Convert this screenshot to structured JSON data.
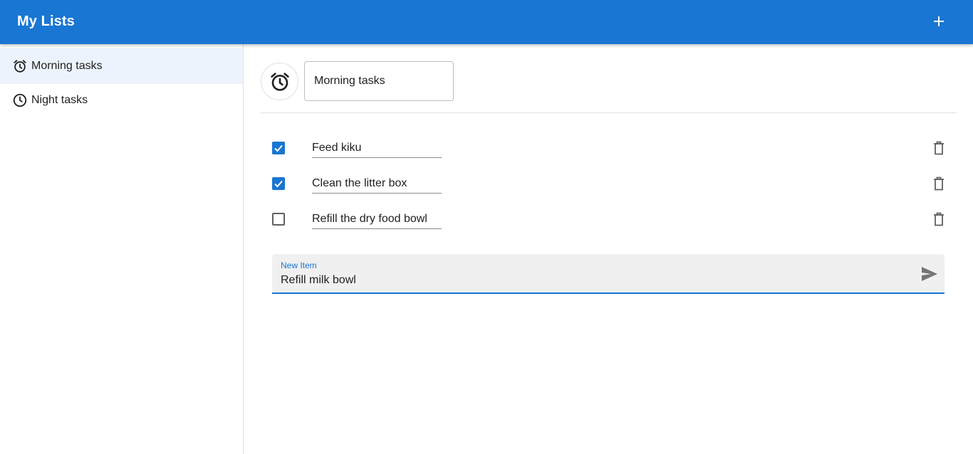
{
  "appbar": {
    "title": "My Lists",
    "add_icon": "plus-icon",
    "color": "#1976d2"
  },
  "sidebar": {
    "items": [
      {
        "label": "Morning tasks",
        "icon": "alarm-clock-icon",
        "selected": true
      },
      {
        "label": "Night tasks",
        "icon": "clock-icon",
        "selected": false
      }
    ],
    "selected_bg": "#edf3fc"
  },
  "main": {
    "list_icon": "alarm-clock-icon",
    "list_name": "Morning tasks",
    "items": [
      {
        "text": "Feed kiku",
        "checked": true
      },
      {
        "text": "Clean the litter box",
        "checked": true
      },
      {
        "text": "Refill the dry food bowl",
        "checked": false
      }
    ],
    "new_item": {
      "label": "New Item",
      "value": "Refill milk bowl",
      "send_icon": "send-icon"
    }
  },
  "colors": {
    "accent": "#1976d2",
    "icon_gray": "#616161"
  }
}
